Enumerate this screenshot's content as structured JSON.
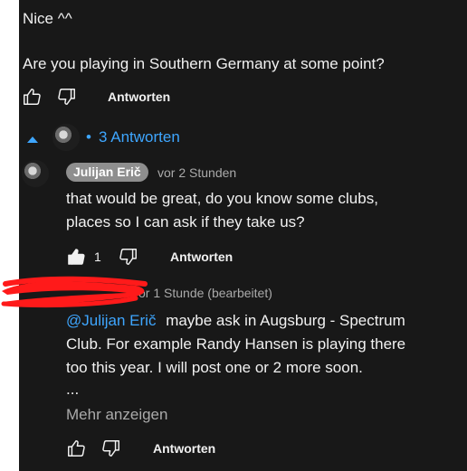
{
  "comment": {
    "line1": "Nice ^^",
    "line2": "Are you playing in Southern Germany at some point?",
    "reply_label": "Antworten"
  },
  "thread": {
    "toggle_label": "3 Antworten",
    "bullet": "•"
  },
  "reply1": {
    "author": "Julijan Erič",
    "time": "vor 2 Stunden",
    "line1": "that would be great, do you know some clubs,",
    "line2": "places so I can ask if they take us?",
    "like_count": "1",
    "reply_label": "Antworten"
  },
  "reply2": {
    "time": "vor 1 Stunde (bearbeitet)",
    "mention": "@Julijan Erič",
    "line1_rest": "maybe ask in Augsburg - Spectrum",
    "line2": "Club. For example Randy Hansen is playing there",
    "line3": "too this year. I will post one or 2 more soon.",
    "ellipsis": "...",
    "show_more": "Mehr anzeigen",
    "reply_label": "Antworten"
  },
  "colors": {
    "background": "#181818",
    "text": "#f1f1f1",
    "link": "#3ea6ff",
    "muted": "#aaaaaa",
    "chip": "#8e8e8e",
    "redaction": "#ff1a1a"
  }
}
